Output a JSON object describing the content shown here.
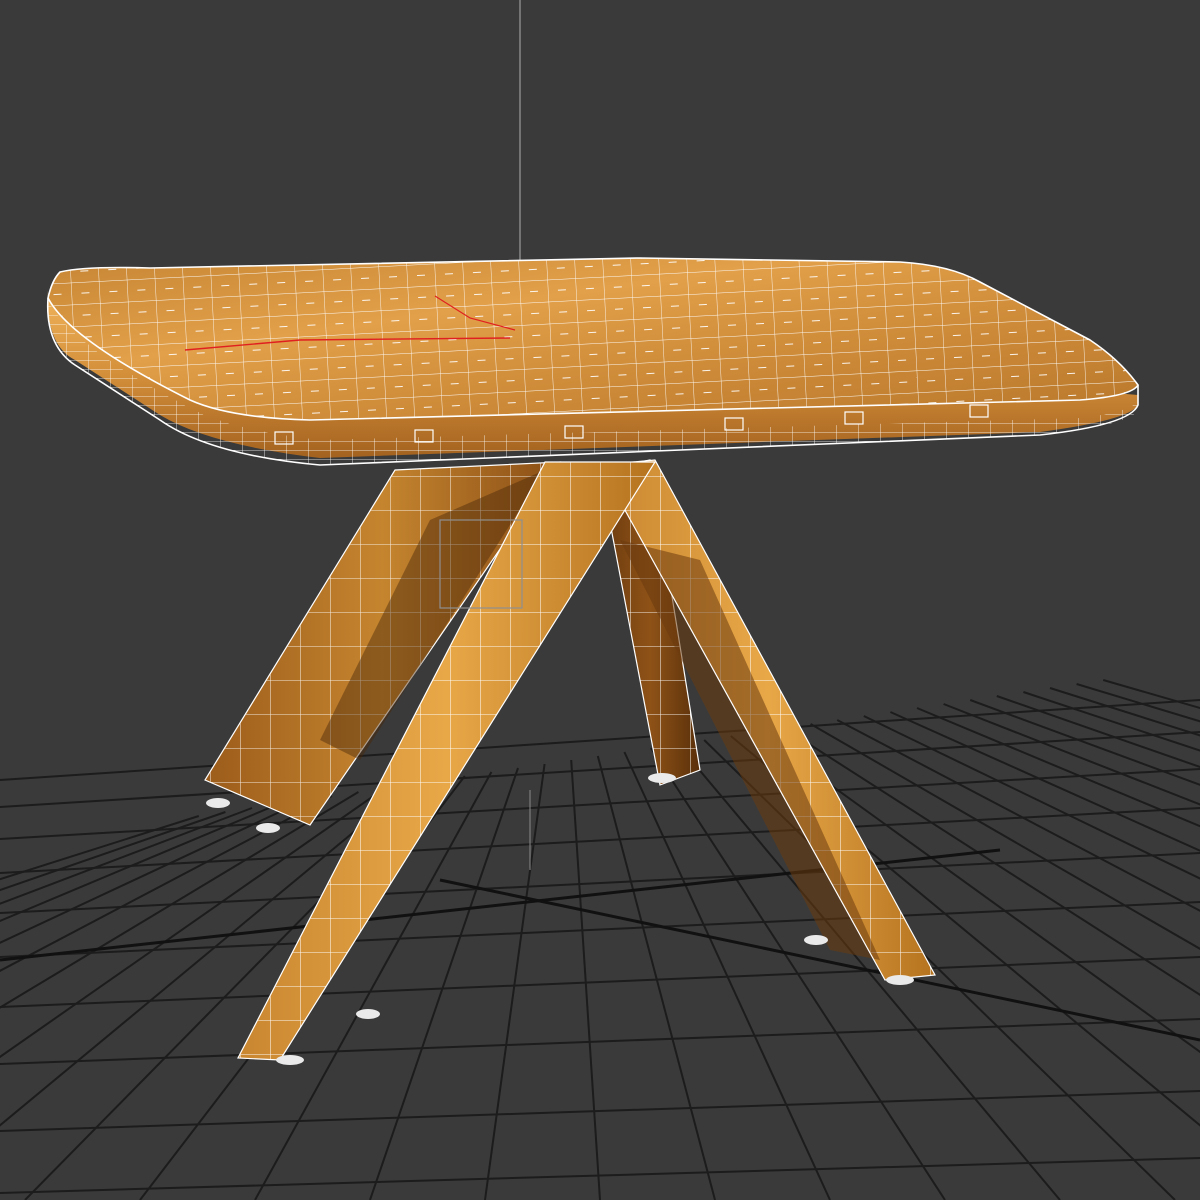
{
  "viewport": {
    "type": "3d-perspective-viewport",
    "background_color": "#3a3a3a",
    "grid_color": "#1c1c1c",
    "grid_visible": true,
    "wireframe_overlay": true,
    "wireframe_color": "#ffffff",
    "selection_gizmo_color": "#e02020"
  },
  "scene": {
    "object": {
      "kind": "table",
      "material": "wood",
      "material_colors": {
        "light": "#e6a247",
        "mid": "#c27f2b",
        "dark": "#7a4511",
        "shadow": "#4a2808"
      },
      "parts": [
        "tabletop",
        "leg-front-left",
        "leg-front-right",
        "leg-back-left",
        "leg-back-right"
      ]
    }
  }
}
